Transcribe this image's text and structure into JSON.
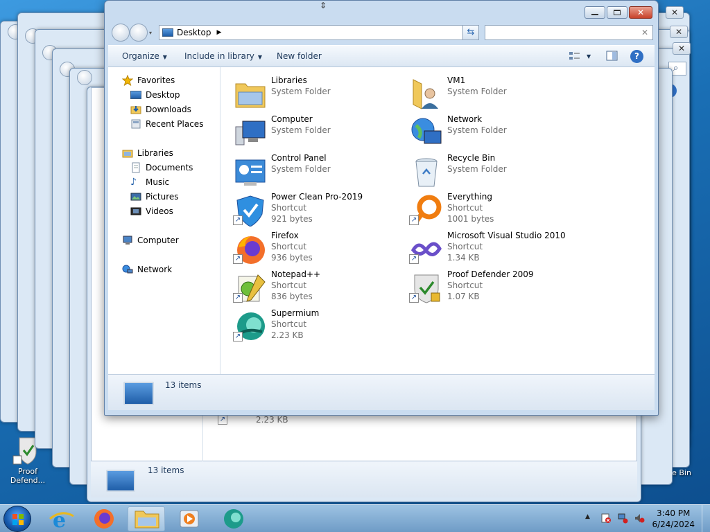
{
  "window": {
    "address": "Desktop",
    "search_placeholder": ""
  },
  "toolbar": {
    "organize": "Organize",
    "include_in_library": "Include in library",
    "new_folder": "New folder"
  },
  "nav": {
    "favorites": "Favorites",
    "desktop": "Desktop",
    "downloads": "Downloads",
    "recent_places": "Recent Places",
    "libraries": "Libraries",
    "documents": "Documents",
    "music": "Music",
    "pictures": "Pictures",
    "videos": "Videos",
    "computer": "Computer",
    "network": "Network"
  },
  "files": [
    {
      "name": "Libraries",
      "type": "System Folder",
      "size": ""
    },
    {
      "name": "VM1",
      "type": "System Folder",
      "size": ""
    },
    {
      "name": "Computer",
      "type": "System Folder",
      "size": ""
    },
    {
      "name": "Network",
      "type": "System Folder",
      "size": ""
    },
    {
      "name": "Control Panel",
      "type": "System Folder",
      "size": ""
    },
    {
      "name": "Recycle Bin",
      "type": "System Folder",
      "size": ""
    },
    {
      "name": "Power Clean Pro-2019",
      "type": "Shortcut",
      "size": "921 bytes"
    },
    {
      "name": "Everything",
      "type": "Shortcut",
      "size": "1001 bytes"
    },
    {
      "name": "Firefox",
      "type": "Shortcut",
      "size": "936 bytes"
    },
    {
      "name": "Microsoft Visual Studio 2010",
      "type": "Shortcut",
      "size": "1.34 KB"
    },
    {
      "name": "Notepad++",
      "type": "Shortcut",
      "size": "836 bytes"
    },
    {
      "name": "Proof Defender 2009",
      "type": "Shortcut",
      "size": "1.07 KB"
    },
    {
      "name": "Supermium",
      "type": "Shortcut",
      "size": "2.23 KB"
    }
  ],
  "details": {
    "count": "13 items"
  },
  "background": {
    "count": "13 items",
    "size": "2.23 KB"
  },
  "desktop_icons": {
    "proof": "Proof Defend...",
    "recycle": "cle Bin"
  },
  "clock": {
    "time": "3:40 PM",
    "date": "6/24/2024"
  },
  "colors": {
    "accent": "#1a6fb5",
    "window_frame": "#c9dcf0",
    "close_button": "#c8412a"
  }
}
